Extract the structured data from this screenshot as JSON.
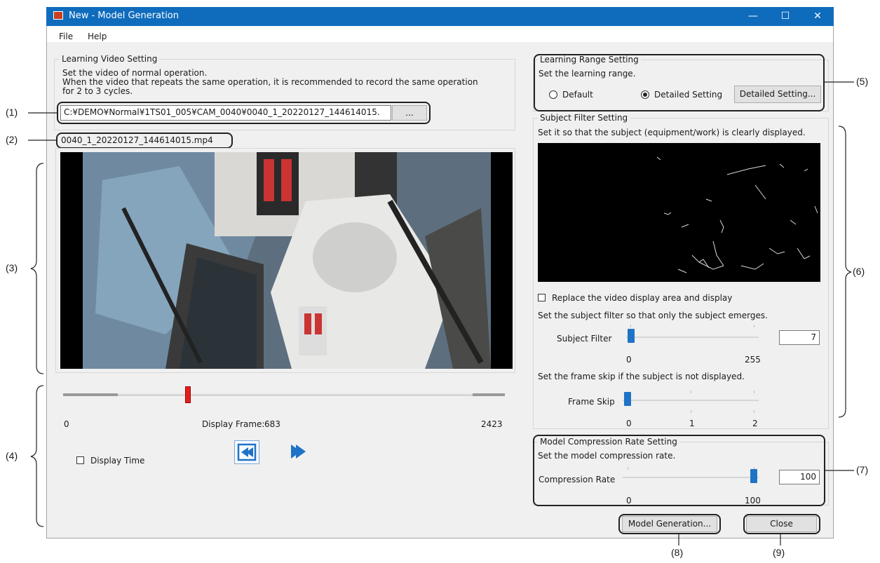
{
  "window": {
    "title": "New - Model Generation",
    "controls": [
      "—",
      "☐",
      "✕"
    ]
  },
  "menu": {
    "file": "File",
    "help": "Help"
  },
  "learning_video": {
    "group_title": "Learning Video Setting",
    "desc_line1": "Set the video of normal operation.",
    "desc_line2": "When the video that repeats the same operation, it is recommended to record the same operation",
    "desc_line3": "for 2 to 3 cycles.",
    "path_value": "C:¥DEMO¥Normal¥1TS01_005¥CAM_0040¥0040_1_20220127_144614015.",
    "browse_label": "...",
    "file_name": "0040_1_20220127_144614015.mp4"
  },
  "playback": {
    "frame_min": "0",
    "frame_label": "Display Frame:",
    "frame_value": "683",
    "frame_max": "2423",
    "frame_fraction": 0.282,
    "display_time_label": "Display Time",
    "display_time_checked": false,
    "prev_icon": "rewind-icon",
    "next_icon": "play-forward-icon"
  },
  "learning_range": {
    "group_title": "Learning Range Setting",
    "desc": "Set the learning range.",
    "default_label": "Default",
    "detailed_label": "Detailed Setting",
    "selected": "Detailed Setting",
    "detailed_button": "Detailed Setting..."
  },
  "subject_filter": {
    "group_title": "Subject Filter Setting",
    "desc": "Set it so that the subject (equipment/work) is clearly displayed.",
    "replace_label": "Replace the video display area and display",
    "replace_checked": false,
    "filter_desc": "Set the subject filter so that only the subject emerges.",
    "filter_label": "Subject Filter",
    "filter_value": "7",
    "filter_min": "0",
    "filter_max": "255",
    "skip_desc": "Set the frame skip if the subject is not displayed.",
    "skip_label": "Frame Skip",
    "skip_ticks": [
      "0",
      "1",
      "2"
    ],
    "skip_value": 0
  },
  "compression": {
    "group_title": "Model Compression Rate Setting",
    "desc": "Set the model compression rate.",
    "label": "Compression Rate",
    "value": "100",
    "min": "0",
    "max": "100"
  },
  "buttons": {
    "model_generation": "Model Generation...",
    "close": "Close"
  },
  "callouts": {
    "c1": "(1)",
    "c2": "(2)",
    "c3": "(3)",
    "c4": "(4)",
    "c5": "(5)",
    "c6": "(6)",
    "c7": "(7)",
    "c8": "(8)",
    "c9": "(9)"
  },
  "colors": {
    "titlebar": "#0f6cbd",
    "accent_thumb": "#1f73c6",
    "frame_marker": "#e02020",
    "nav_button_icon": "#1f73c6"
  }
}
